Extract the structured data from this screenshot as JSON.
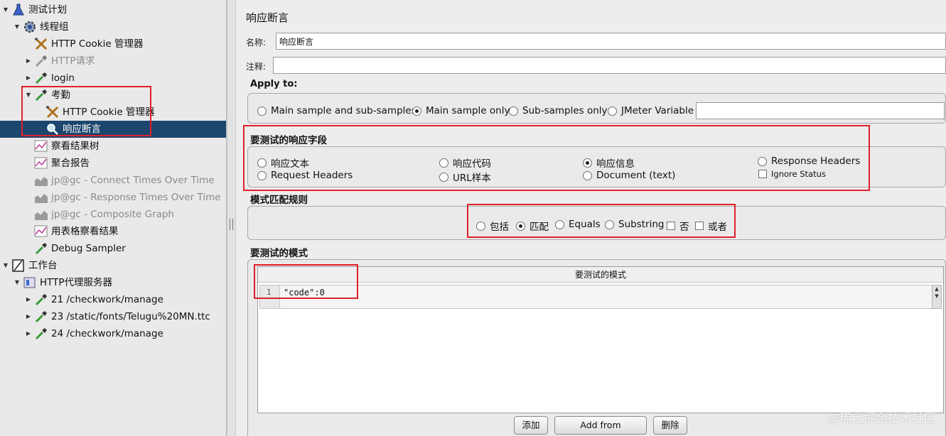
{
  "tree": {
    "nodes": [
      {
        "label": "测试计划",
        "icon": "flask-icon",
        "expanded": true
      },
      {
        "label": "线程组",
        "icon": "gear-icon",
        "expanded": true
      },
      {
        "label": "HTTP Cookie 管理器",
        "icon": "tools-icon"
      },
      {
        "label": "HTTP请求",
        "icon": "pipette-icon",
        "disabled": true
      },
      {
        "label": "login",
        "icon": "pipette-icon"
      },
      {
        "label": "考勤",
        "icon": "pipette-icon",
        "expanded": true
      },
      {
        "label": "HTTP Cookie 管理器",
        "icon": "tools-icon"
      },
      {
        "label": "响应断言",
        "icon": "magnifier-icon",
        "selected": true
      },
      {
        "label": "察看结果树",
        "icon": "graph-icon"
      },
      {
        "label": "聚合报告",
        "icon": "graph-icon"
      },
      {
        "label": "jp@gc - Connect Times Over Time",
        "icon": "chart-icon",
        "disabled": true
      },
      {
        "label": "jp@gc - Response Times Over Time",
        "icon": "chart-icon",
        "disabled": true
      },
      {
        "label": "jp@gc - Composite Graph",
        "icon": "chart-icon",
        "disabled": true
      },
      {
        "label": "用表格察看结果",
        "icon": "graph-icon"
      },
      {
        "label": "Debug Sampler",
        "icon": "pipette-icon"
      },
      {
        "label": "工作台",
        "icon": "workbench-icon",
        "expanded": true
      },
      {
        "label": "HTTP代理服务器",
        "icon": "proxy-icon",
        "expanded": true
      },
      {
        "label": "21 /checkwork/manage",
        "icon": "pipette-icon"
      },
      {
        "label": "23 /static/fonts/Telugu%20MN.ttc",
        "icon": "pipette-icon"
      },
      {
        "label": "24 /checkwork/manage",
        "icon": "pipette-icon"
      }
    ]
  },
  "panel": {
    "title": "响应断言",
    "name_label": "名称:",
    "name_value": "响应断言",
    "comment_label": "注释:",
    "comment_value": "",
    "apply_to": {
      "title": "Apply to:",
      "options": [
        "Main sample and sub-samples",
        "Main sample only",
        "Sub-samples only",
        "JMeter Variable"
      ],
      "selected": "Main sample only",
      "variable_value": ""
    },
    "response_field": {
      "title": "要测试的响应字段",
      "options": [
        "响应文本",
        "响应代码",
        "响应信息",
        "Response Headers",
        "Request Headers",
        "URL样本",
        "Document (text)"
      ],
      "selected": "响应信息",
      "ignore_status_label": "Ignore Status",
      "ignore_status_checked": false
    },
    "pattern_rules": {
      "title": "模式匹配规则",
      "options": [
        "包括",
        "匹配",
        "Equals",
        "Substring"
      ],
      "selected": "匹配",
      "not_label": "否",
      "or_label": "或者"
    },
    "patterns": {
      "title": "要测试的模式",
      "column_header": "要测试的模式",
      "rows": [
        {
          "line": "1",
          "text": "\"code\":0"
        }
      ]
    },
    "buttons": {
      "add": "添加",
      "add_clipboard": "Add from Clipboard",
      "delete": "删除"
    }
  },
  "watermark": "@稀土掘金技术社区",
  "colors": {
    "selection": "#1c466d",
    "highlight_box": "#e0202a"
  }
}
